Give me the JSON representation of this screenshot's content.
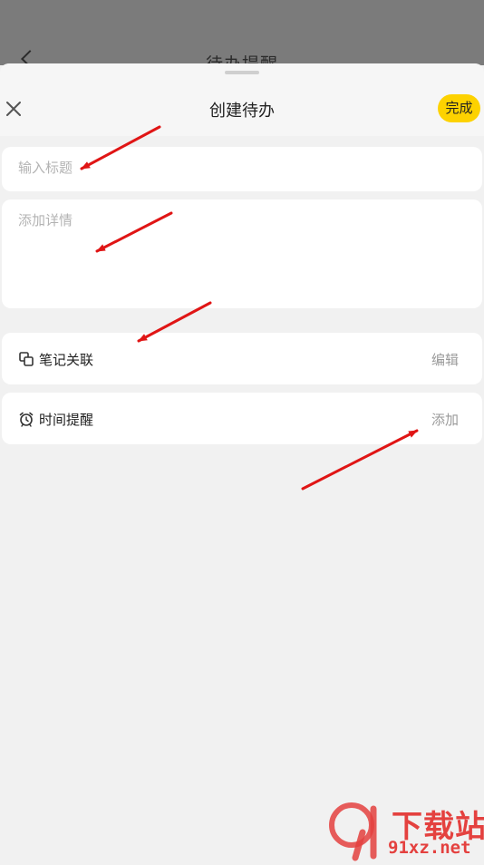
{
  "background_screen": {
    "title": "待办提醒"
  },
  "sheet": {
    "title": "创建待办",
    "done_label": "完成"
  },
  "form": {
    "title_placeholder": "输入标题",
    "detail_placeholder": "添加详情"
  },
  "rows": {
    "note_link": {
      "icon": "note-link-icon",
      "label": "笔记关联",
      "action": "编辑"
    },
    "reminder": {
      "icon": "alarm-clock-icon",
      "label": "时间提醒",
      "action": "添加"
    }
  },
  "watermark": {
    "line1": "下载站",
    "line2": "91xz.net"
  },
  "colors": {
    "accent": "#fdd200",
    "annotation_arrow": "#e01515",
    "page_background": "#f1f1f1",
    "watermark": "#e4413f"
  }
}
